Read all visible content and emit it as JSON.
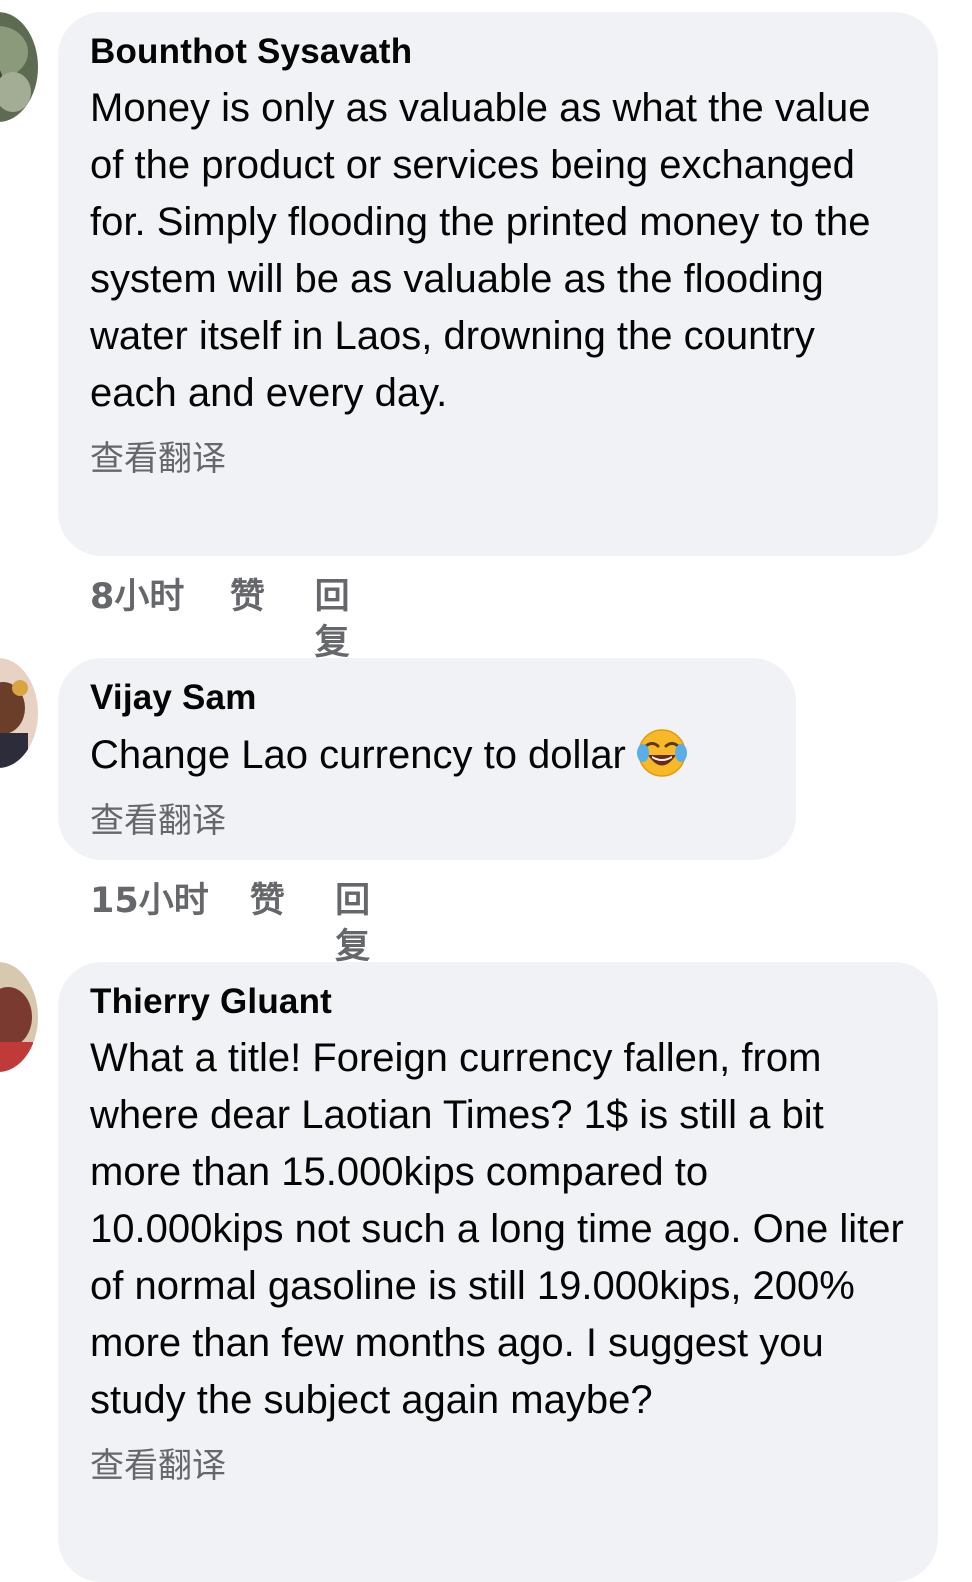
{
  "comments": [
    {
      "author": "Bounthot Sysavath",
      "text": "Money is only as valuable as what the value of the product or services being exchanged for. Simply flooding the printed money to the system will be as valuable as the flooding water itself in Laos, drowning the country each and every day.",
      "translate_label": "查看翻译",
      "time": "8小时",
      "like_label": "赞",
      "reply_label": "回复",
      "avatar_icon": "user-avatar-photo"
    },
    {
      "author": "Vijay Sam",
      "text": "Change Lao currency to dollar",
      "emoji": "face-with-tears-of-joy-icon",
      "translate_label": "查看翻译",
      "time": "15小时",
      "like_label": "赞",
      "reply_label": "回复",
      "avatar_icon": "user-avatar-photo"
    },
    {
      "author": "Thierry Gluant",
      "text": "What a title! Foreign currency fallen, from where dear Laotian Times? 1$ is still a bit more than 15.000kips compared to 10.000kips not such a long time ago. One liter of normal gasoline is still 19.000kips, 200% more than few months ago. I suggest you study the subject again maybe?",
      "translate_label": "查看翻译",
      "avatar_icon": "user-avatar-photo"
    }
  ],
  "colors": {
    "bubble_bg": "#f0f2f5",
    "text": "#050505",
    "secondary_text": "#65676b"
  }
}
